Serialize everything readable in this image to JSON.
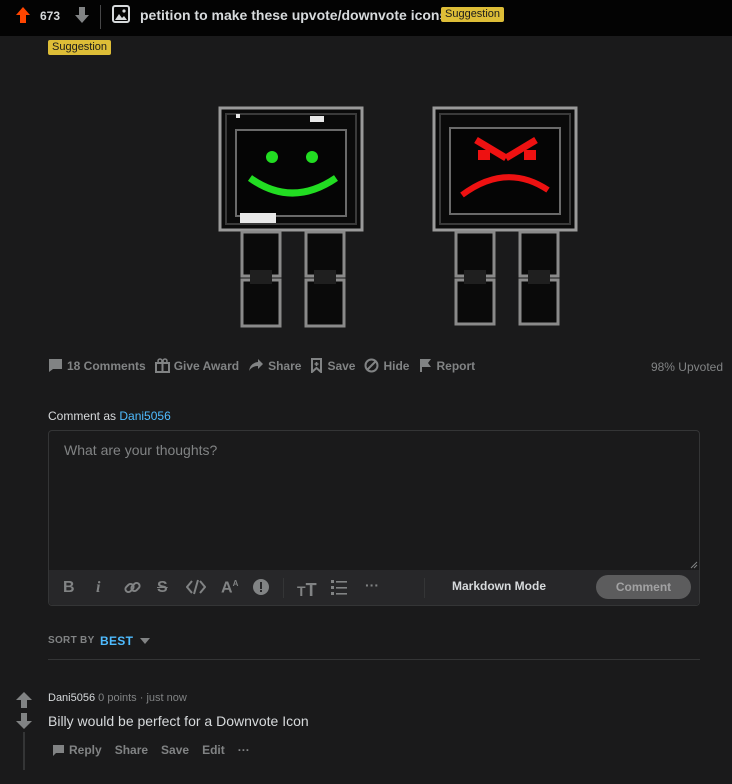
{
  "post": {
    "score": "673",
    "title": "petition to make these upvote/downvote icons",
    "flair": "Suggestion",
    "flair_color": "#ddbd37"
  },
  "actions": {
    "comments": "18 Comments",
    "award": "Give Award",
    "share": "Share",
    "save": "Save",
    "hide": "Hide",
    "report": "Report",
    "upvoted": "98% Upvoted"
  },
  "editor": {
    "comment_as_prefix": "Comment as",
    "username": "Dani5056",
    "placeholder": "What are your thoughts?",
    "markdown_mode": "Markdown Mode",
    "comment_button": "Comment",
    "toolbar_icons": [
      "bold-icon",
      "italic-icon",
      "link-icon",
      "strikethrough-icon",
      "code-icon",
      "superscript-icon",
      "spoiler-icon",
      "heading-icon",
      "list-icon",
      "more-icon"
    ]
  },
  "sort": {
    "label": "SORT BY",
    "value": "BEST"
  },
  "comment": {
    "author": "Dani5056",
    "points": "0 points",
    "separator": "·",
    "time": "just now",
    "body": "Billy would be perfect for a Downvote Icon",
    "reply": "Reply",
    "share": "Share",
    "save": "Save",
    "edit": "Edit",
    "more": "···"
  },
  "colors": {
    "upvote": "#ff4500",
    "link": "#4fbcff",
    "happy_face": "#22dd22",
    "angry_face": "#ee1111"
  }
}
